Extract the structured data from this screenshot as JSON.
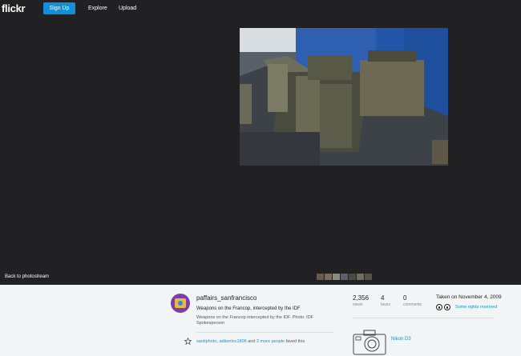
{
  "header": {
    "logo": "flickr",
    "signup_label": "Sign Up",
    "explore_label": "Explore",
    "upload_label": "Upload"
  },
  "viewer": {
    "back_label": "Back to photostream",
    "thumbnail_count": 7
  },
  "photo_info": {
    "username": "paffairs_sanfrancisco",
    "title": "Weapons on the Francop, intercepted by the IDF",
    "description": "Weapons on the Francop intercepted by the IDF. Photo: IDF Spokesperson",
    "faves": {
      "user1": "santiphoto",
      "sep1": ", ",
      "user2": "adtienloc1806",
      "sep2": " and ",
      "more": "2 more people",
      "suffix": " faved this"
    }
  },
  "stats": {
    "views": {
      "value": "2,356",
      "label": "views"
    },
    "faves": {
      "value": "4",
      "label": "faves"
    },
    "comments": {
      "value": "0",
      "label": "comments"
    }
  },
  "meta": {
    "taken": "Taken on November 4, 2009",
    "rights": "Some rights reserved",
    "camera": "Nikon D3"
  },
  "colors": {
    "brand_blue": "#128fdc",
    "dark_bg": "#212124",
    "light_bg": "#f2f5f6"
  }
}
